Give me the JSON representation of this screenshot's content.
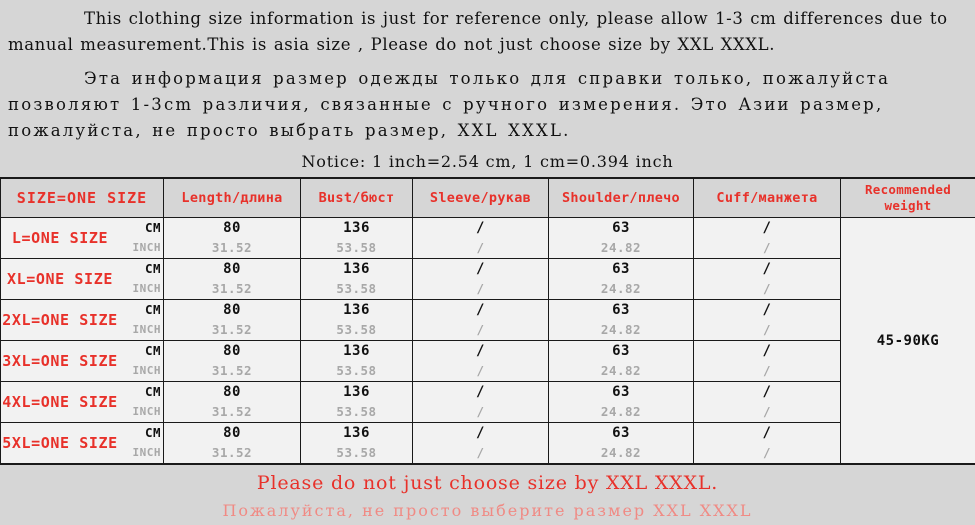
{
  "intro": {
    "english": "This clothing size information is just for reference only, please allow 1-3 cm differences due to manual measurement.This is asia size , Please do not just choose size by XXL XXXL.",
    "russian": "Эта информация размер одежды только для справки только, пожалуйста позволяют 1-3cm различия, связанные с ручного измерения. Это Азии размер, пожалуйста, не просто выбрать размер, XXL XXXL.",
    "notice": "Notice: 1 inch=2.54 cm, 1 cm=0.394 inch"
  },
  "table": {
    "headers": [
      "SIZE=ONE SIZE",
      "Length/длина",
      "Bust/бюст",
      "Sleeve/рукав",
      "Shoulder/плечо",
      "Cuff/манжета",
      "Recommended weight"
    ],
    "unit_labels": {
      "cm": "CM",
      "inch": "INCH"
    },
    "recommended_weight": "45-90KG",
    "rows": [
      {
        "size": "L=ONE SIZE",
        "length_cm": "80",
        "length_inch": "31.52",
        "bust_cm": "136",
        "bust_inch": "53.58",
        "sleeve_cm": "/",
        "sleeve_inch": "/",
        "shoulder_cm": "63",
        "shoulder_inch": "24.82",
        "cuff_cm": "/",
        "cuff_inch": "/"
      },
      {
        "size": "XL=ONE SIZE",
        "length_cm": "80",
        "length_inch": "31.52",
        "bust_cm": "136",
        "bust_inch": "53.58",
        "sleeve_cm": "/",
        "sleeve_inch": "/",
        "shoulder_cm": "63",
        "shoulder_inch": "24.82",
        "cuff_cm": "/",
        "cuff_inch": "/"
      },
      {
        "size": "2XL=ONE SIZE",
        "length_cm": "80",
        "length_inch": "31.52",
        "bust_cm": "136",
        "bust_inch": "53.58",
        "sleeve_cm": "/",
        "sleeve_inch": "/",
        "shoulder_cm": "63",
        "shoulder_inch": "24.82",
        "cuff_cm": "/",
        "cuff_inch": "/"
      },
      {
        "size": "3XL=ONE SIZE",
        "length_cm": "80",
        "length_inch": "31.52",
        "bust_cm": "136",
        "bust_inch": "53.58",
        "sleeve_cm": "/",
        "sleeve_inch": "/",
        "shoulder_cm": "63",
        "shoulder_inch": "24.82",
        "cuff_cm": "/",
        "cuff_inch": "/"
      },
      {
        "size": "4XL=ONE SIZE",
        "length_cm": "80",
        "length_inch": "31.52",
        "bust_cm": "136",
        "bust_inch": "53.58",
        "sleeve_cm": "/",
        "sleeve_inch": "/",
        "shoulder_cm": "63",
        "shoulder_inch": "24.82",
        "cuff_cm": "/",
        "cuff_inch": "/"
      },
      {
        "size": "5XL=ONE SIZE",
        "length_cm": "80",
        "length_inch": "31.52",
        "bust_cm": "136",
        "bust_inch": "53.58",
        "sleeve_cm": "/",
        "sleeve_inch": "/",
        "shoulder_cm": "63",
        "shoulder_inch": "24.82",
        "cuff_cm": "/",
        "cuff_inch": "/"
      }
    ]
  },
  "footer": {
    "english": "Please do not just choose size by XXL XXXL.",
    "russian": "Пожалуйста, не просто выберите размер XXL XXXL"
  },
  "colors": {
    "page_background": "#d6d6d6",
    "cell_background": "#f2f2f2",
    "header_red": "#e8312a",
    "footer_red_light": "#f08a84",
    "text_black": "#111111",
    "inch_gray": "#a8a8a8",
    "border": "#1a1a1a"
  }
}
